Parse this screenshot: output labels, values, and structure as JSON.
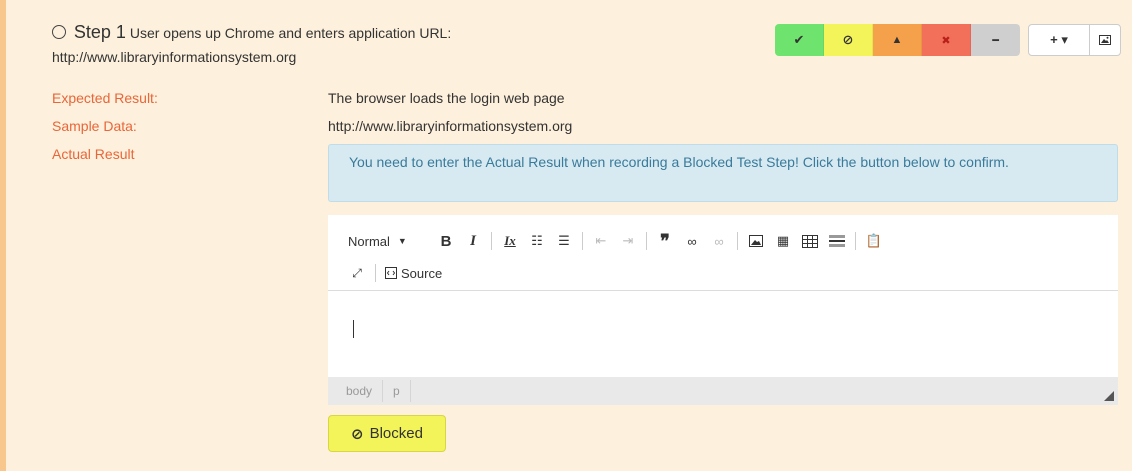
{
  "step": {
    "number_label": "Step 1",
    "description": "User opens up Chrome and enters application URL:",
    "url": "http://www.libraryinformationsystem.org"
  },
  "status_buttons": [
    {
      "name": "pass",
      "icon": "checkmark-icon",
      "glyph": "✔",
      "color": "#6ee36e"
    },
    {
      "name": "blocked",
      "icon": "blocked-icon",
      "glyph": "⊘",
      "color": "#f3f35a"
    },
    {
      "name": "caution",
      "icon": "warning-icon",
      "glyph": "▲",
      "color": "#f5a04a"
    },
    {
      "name": "fail",
      "icon": "x-icon",
      "glyph": "✖",
      "color": "#f2705a"
    },
    {
      "name": "not-applicable",
      "icon": "minus-icon",
      "glyph": "━",
      "color": "#cfcfcf"
    }
  ],
  "tools": {
    "add_glyph": "+ ▾",
    "image_glyph": "🖼"
  },
  "fields": {
    "expected_label": "Expected Result:",
    "expected_value": "The browser loads the login web page",
    "sample_label": "Sample Data:",
    "sample_value": "http://www.libraryinformationsystem.org",
    "actual_label": "Actual Result"
  },
  "alert": {
    "message": "You need to enter the Actual Result when recording a Blocked Test Step! Click the button below to confirm."
  },
  "editor": {
    "format_value": "Normal",
    "source_label": "Source",
    "path": [
      "body",
      "p"
    ],
    "content": ""
  },
  "blocked_button": {
    "label": "Blocked"
  }
}
